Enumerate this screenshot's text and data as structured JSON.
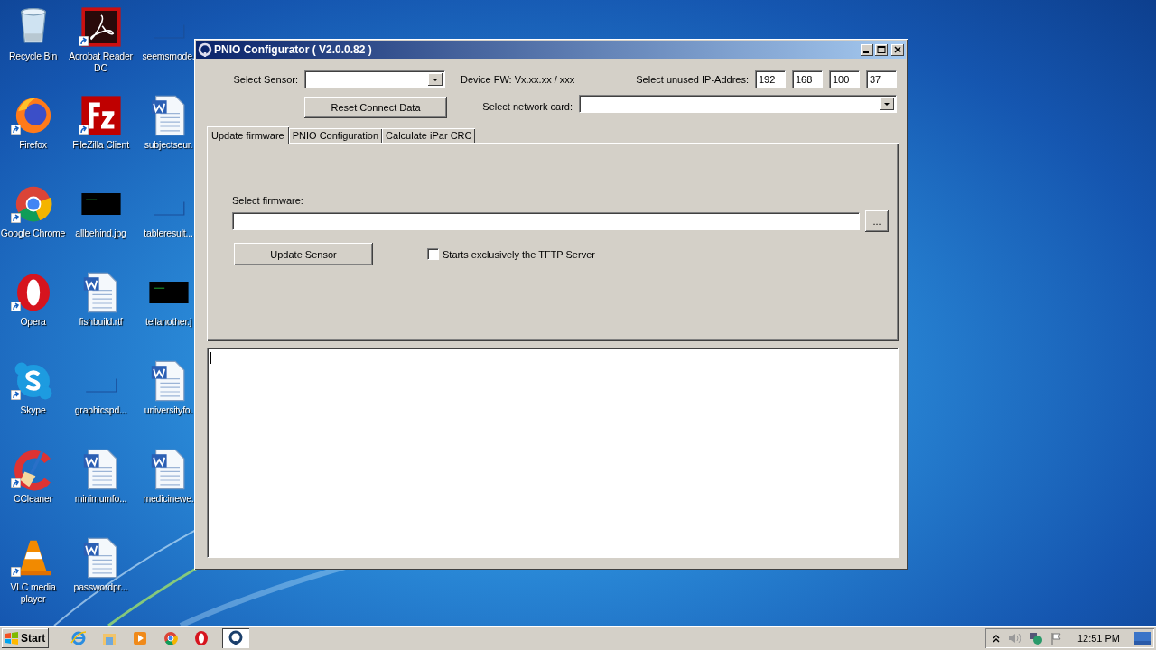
{
  "desktop": {
    "icons": [
      {
        "label": "Recycle Bin",
        "kind": "recycle",
        "shortcut": false
      },
      {
        "label": "Firefox",
        "kind": "firefox",
        "shortcut": true
      },
      {
        "label": "Google Chrome",
        "kind": "chrome",
        "shortcut": true
      },
      {
        "label": "Opera",
        "kind": "opera",
        "shortcut": true
      },
      {
        "label": "Skype",
        "kind": "skype",
        "shortcut": true
      },
      {
        "label": "CCleaner",
        "kind": "ccleaner",
        "shortcut": true
      },
      {
        "label": "VLC media player",
        "kind": "vlc",
        "shortcut": true
      },
      {
        "label": "Acrobat Reader DC",
        "kind": "acrobat",
        "shortcut": true
      },
      {
        "label": "FileZilla Client",
        "kind": "filezilla",
        "shortcut": true
      },
      {
        "label": "allbehind.jpg",
        "kind": "dark",
        "shortcut": false
      },
      {
        "label": "fishbuild.rtf",
        "kind": "word",
        "shortcut": false
      },
      {
        "label": "graphicspd...",
        "kind": "blank",
        "shortcut": false
      },
      {
        "label": "minimumfo...",
        "kind": "word",
        "shortcut": false
      },
      {
        "label": "passwordpr...",
        "kind": "word",
        "shortcut": false
      },
      {
        "label": "seemsmode.",
        "kind": "blank",
        "shortcut": false
      },
      {
        "label": "subjectseur.",
        "kind": "word",
        "shortcut": false
      },
      {
        "label": "tableresult...",
        "kind": "blank",
        "shortcut": false
      },
      {
        "label": "tellanother.j",
        "kind": "dark",
        "shortcut": false
      },
      {
        "label": "universityfo.",
        "kind": "word",
        "shortcut": false
      },
      {
        "label": "medicinewe.",
        "kind": "word",
        "shortcut": false
      }
    ]
  },
  "window": {
    "title": "PNIO Configurator ( V2.0.0.82 )",
    "sensor": {
      "label": "Select Sensor:"
    },
    "device_fw": "Device FW: Vx.xx.xx / xxx",
    "ip": {
      "label": "Select unused IP-Addres:",
      "octets": [
        "192",
        "168",
        "100",
        "37"
      ]
    },
    "reset_button": "Reset Connect Data",
    "network_card": {
      "label": "Select network card:"
    },
    "tabs": [
      {
        "label": "Update firmware",
        "selected": true
      },
      {
        "label": "PNIO Configuration",
        "selected": false
      },
      {
        "label": "Calculate iPar CRC",
        "selected": false
      }
    ],
    "firmware": {
      "label": "Select firmware:",
      "browse_button": "...",
      "update_button": "Update Sensor",
      "tftp": {
        "label": "Starts exclusively the TFTP Server",
        "checked": false
      }
    }
  },
  "taskbar": {
    "start": "Start",
    "apps": [
      {
        "kind": "ie",
        "selected": false
      },
      {
        "kind": "explorer",
        "selected": false
      },
      {
        "kind": "media",
        "selected": false
      },
      {
        "kind": "chrome",
        "selected": false
      },
      {
        "kind": "opera",
        "selected": false
      },
      {
        "kind": "pnio",
        "selected": true
      }
    ],
    "clock": "12:51 PM"
  }
}
